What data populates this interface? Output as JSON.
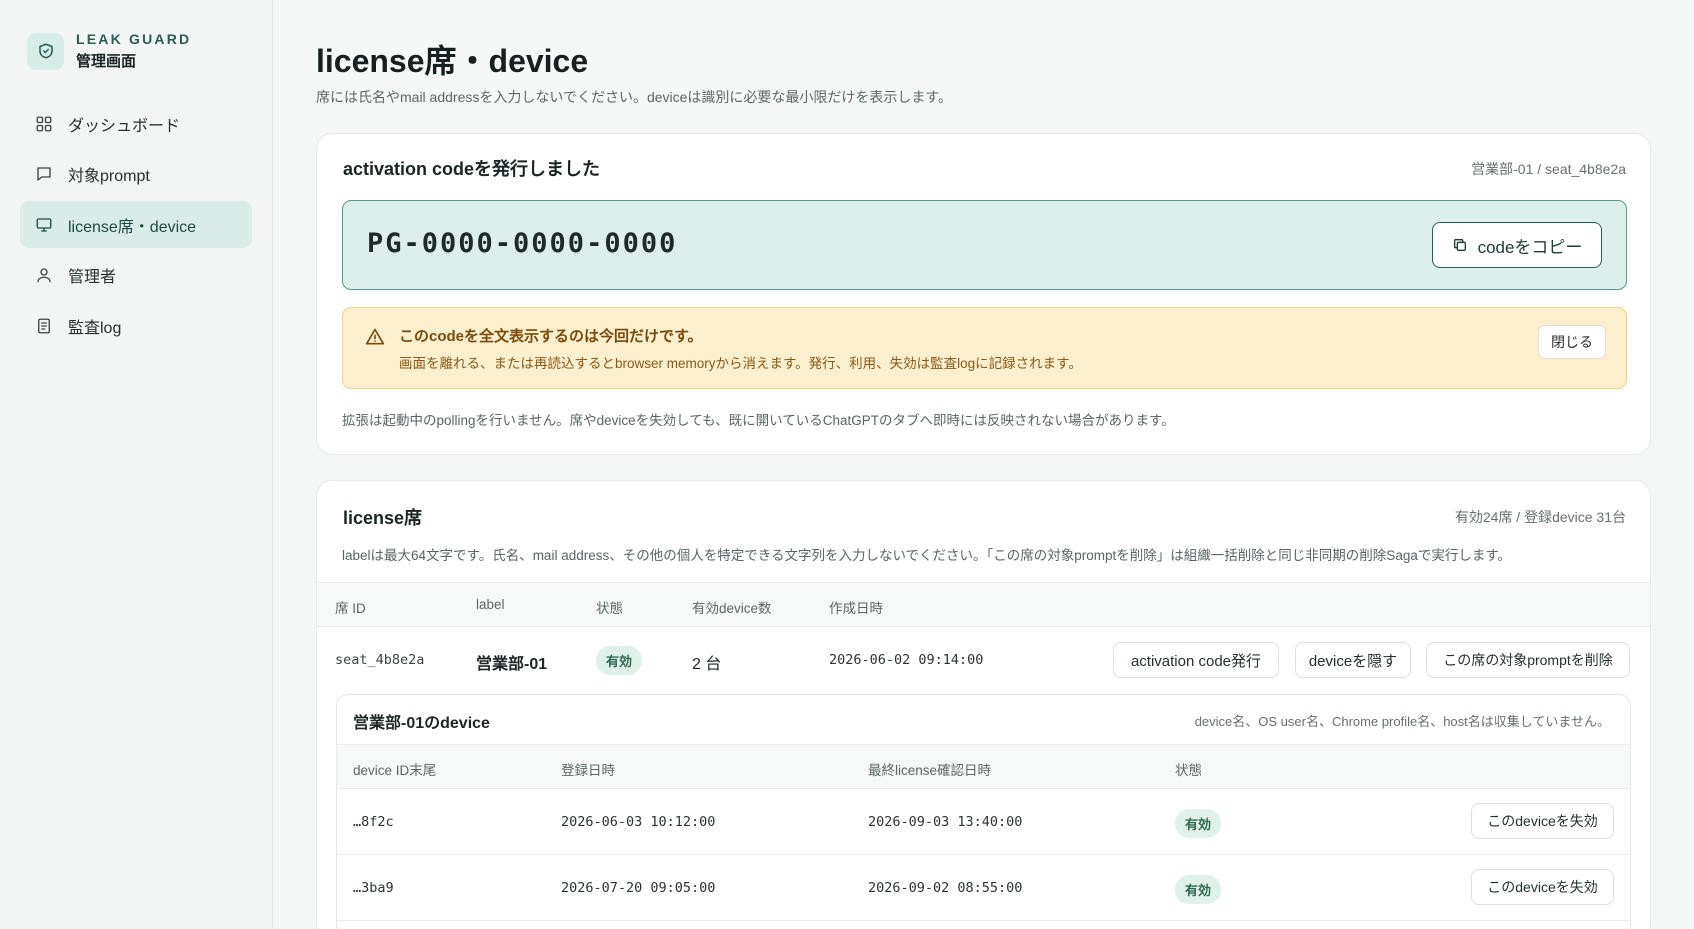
{
  "brand": {
    "name": "LEAK GUARD",
    "subtitle": "管理画面",
    "logo_icon": "shield-check-icon"
  },
  "sidebar": {
    "items": [
      {
        "label": "ダッシュボード",
        "icon": "grid-icon",
        "active": false
      },
      {
        "label": "対象prompt",
        "icon": "message-icon",
        "active": false
      },
      {
        "label": "license席・device",
        "icon": "monitor-icon",
        "active": true
      },
      {
        "label": "管理者",
        "icon": "user-icon",
        "active": false
      },
      {
        "label": "監査log",
        "icon": "document-icon",
        "active": false
      }
    ]
  },
  "page": {
    "title": "license席・device",
    "subtitle": "席には氏名やmail addressを入力しないでください。deviceは識別に必要な最小限だけを表示します。"
  },
  "activation": {
    "title": "activation codeを発行しました",
    "meta": "営業部-01 / seat_4b8e2a",
    "code": "PG-0000-0000-0000",
    "copy_label": "codeをコピー",
    "warning_title": "このcodeを全文表示するのは今回だけです。",
    "warning_desc": "画面を離れる、または再読込するとbrowser memoryから消えます。発行、利用、失効は監査logに記録されます。",
    "close_label": "閉じる",
    "note": "拡張は起動中のpollingを行いません。席やdeviceを失効しても、既に開いているChatGPTのタブへ即時には反映されない場合があります。"
  },
  "seats": {
    "title": "license席",
    "meta": "有効24席 / 登録device 31台",
    "desc": "labelは最大64文字です。氏名、mail address、その他の個人を特定できる文字列を入力しないでください。「この席の対象promptを削除」は組織一括削除と同じ非同期の削除Sagaで実行します。",
    "columns": [
      "席 ID",
      "label",
      "状態",
      "有効device数",
      "作成日時"
    ],
    "row": {
      "id": "seat_4b8e2a",
      "label": "営業部-01",
      "status": "有効",
      "device_count": "2 台",
      "created": "2026-06-02 09:14:00",
      "actions": [
        "activation code発行",
        "deviceを隠す",
        "この席の対象promptを削除"
      ]
    }
  },
  "devices": {
    "title": "営業部-01のdevice",
    "meta": "device名、OS user名、Chrome profile名、host名は収集していません。",
    "columns": [
      "device ID末尾",
      "登録日時",
      "最終license確認日時",
      "状態"
    ],
    "rows": [
      {
        "id": "…8f2c",
        "registered": "2026-06-03 10:12:00",
        "last_check": "2026-09-03 13:40:00",
        "status": "有効",
        "action": "このdeviceを失効"
      },
      {
        "id": "…3ba9",
        "registered": "2026-07-20 09:05:00",
        "last_check": "2026-09-02 08:55:00",
        "status": "有効",
        "action": "このdeviceを失効"
      }
    ]
  },
  "colors": {
    "accent": "#2b5d57",
    "active_nav": "#d9ece7",
    "warning_bg": "#fbefce",
    "code_bg": "#dcefeb"
  }
}
